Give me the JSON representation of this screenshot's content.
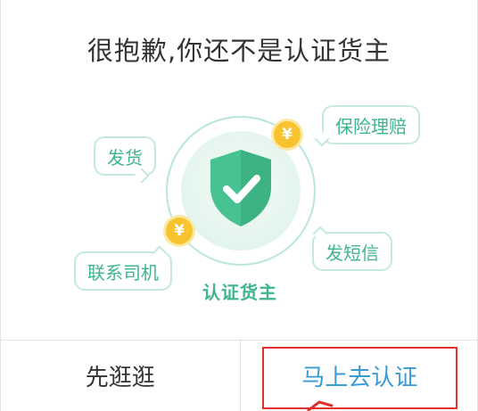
{
  "dialog": {
    "title": "很抱歉,你还不是认证货主",
    "center_label": "认证货主",
    "bubbles": {
      "ship": "发货",
      "insurance_claim": "保险理赔",
      "send_sms": "发短信",
      "contact_driver": "联系司机"
    },
    "coin_symbol": "¥",
    "buttons": {
      "browse": "先逛逛",
      "certify_now": "马上去认证"
    }
  },
  "colors": {
    "accent_green": "#3fb58c",
    "shield_green": "#47c391",
    "coin_yellow": "#f7c42f",
    "link_blue": "#3a9bd4",
    "annotation_red": "#e0312f"
  }
}
